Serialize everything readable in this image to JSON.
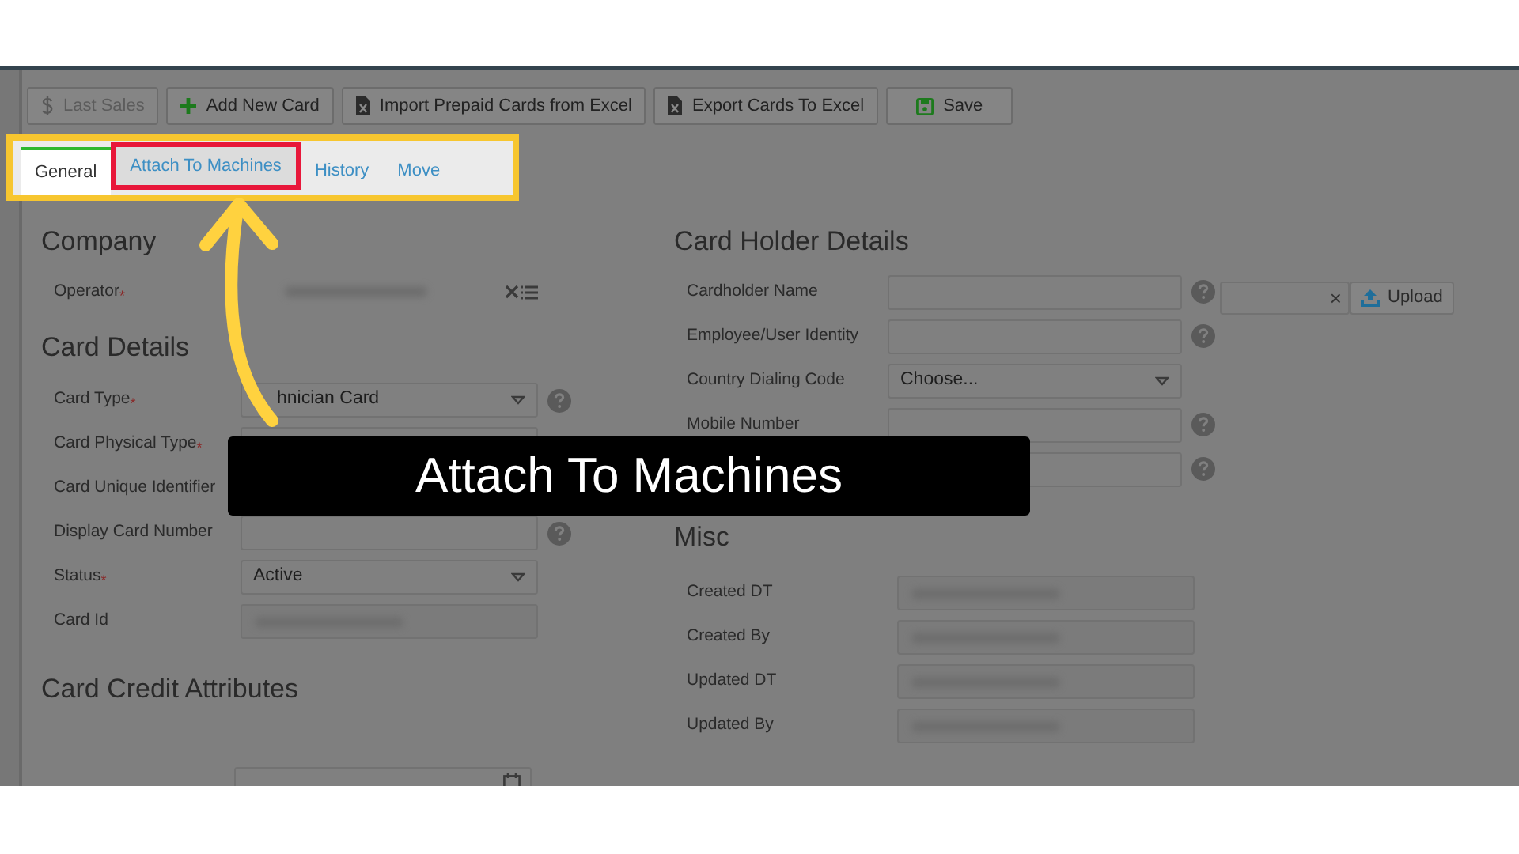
{
  "toolbar": [
    {
      "label": "Last Sales",
      "disabled": true
    },
    {
      "label": "Add New Card",
      "disabled": false
    },
    {
      "label": "Import Prepaid Cards from Excel",
      "disabled": false
    },
    {
      "label": "Export Cards To Excel",
      "disabled": false
    },
    {
      "label": "Save",
      "disabled": false
    }
  ],
  "tabs": [
    {
      "label": "General",
      "selected": true,
      "highlighted": false
    },
    {
      "label": "Attach To Machines",
      "selected": false,
      "highlighted": true
    },
    {
      "label": "History",
      "selected": false,
      "highlighted": false
    },
    {
      "label": "Move",
      "selected": false,
      "highlighted": false
    }
  ],
  "company": {
    "title": "Company",
    "fields": [
      {
        "label": "Operator",
        "required": true,
        "kind": "redacted_plain",
        "help": false
      }
    ]
  },
  "card_details": {
    "title": "Card Details",
    "fields": [
      {
        "label": "Card Type",
        "required": true,
        "kind": "select",
        "value": "hnician Card",
        "help": true
      },
      {
        "label": "Card Physical Type",
        "required": true,
        "kind": "text",
        "help": false
      },
      {
        "label": "Card Unique Identifier",
        "required": false,
        "kind": "covered"
      },
      {
        "label": "Display Card Number",
        "required": false,
        "kind": "text",
        "help": true
      },
      {
        "label": "Status",
        "required": true,
        "kind": "select",
        "value": "Active",
        "help": false
      },
      {
        "label": "Card Id",
        "required": false,
        "kind": "redacted",
        "help": false
      }
    ]
  },
  "card_credit_attributes": {
    "title": "Card Credit Attributes"
  },
  "card_holder_details": {
    "title": "Card Holder Details",
    "fields": [
      {
        "label": "Cardholder Name",
        "required": false,
        "kind": "text",
        "help": true
      },
      {
        "label": "Employee/User Identity",
        "required": false,
        "kind": "text",
        "help": true
      },
      {
        "label": "Country Dialing Code",
        "required": false,
        "kind": "select",
        "value": "Choose...",
        "help": false
      },
      {
        "label": "Mobile Number",
        "required": false,
        "kind": "text",
        "help": true
      },
      {
        "required": false,
        "kind": "text",
        "help": true
      }
    ],
    "upload": {
      "clear": "×",
      "button": "Upload"
    }
  },
  "misc": {
    "title": "Misc",
    "fields": [
      {
        "label": "Created DT",
        "required": false,
        "kind": "redacted",
        "help": false
      },
      {
        "label": "Created By",
        "required": false,
        "kind": "redacted",
        "help": false
      },
      {
        "label": "Updated DT",
        "required": false,
        "kind": "redacted",
        "help": false
      },
      {
        "label": "Updated By",
        "required": false,
        "kind": "redacted",
        "help": false
      }
    ]
  },
  "required_mark": "*",
  "caption": "Attach To Machines"
}
